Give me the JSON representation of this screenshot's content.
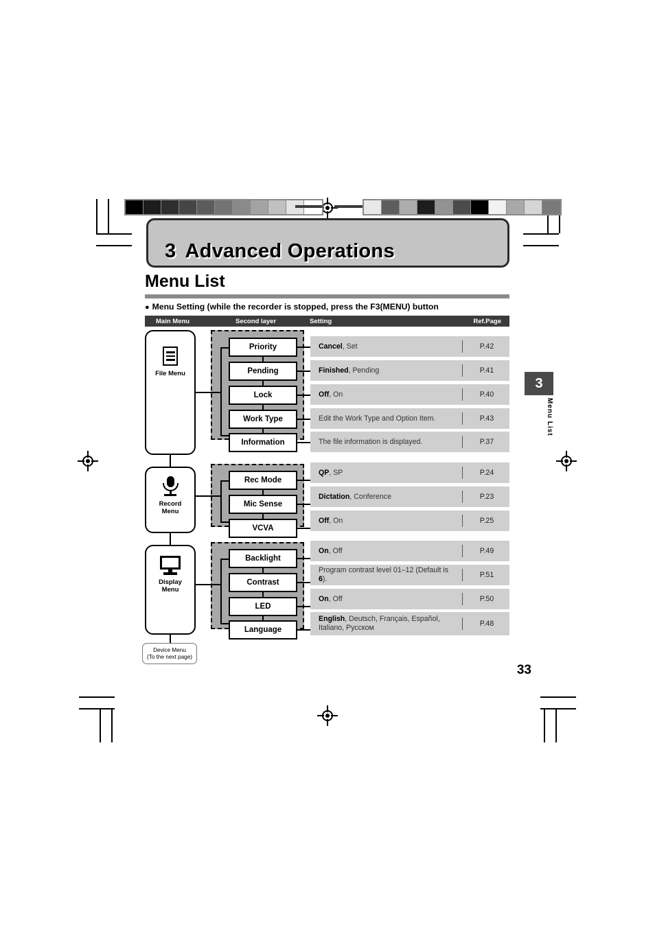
{
  "page": {
    "number": "33",
    "chapter_number": "3",
    "chapter_title": "Advanced Operations",
    "section_title": "Menu List",
    "bullet_text": "Menu Setting (while the recorder is stopped, press the F3(MENU) button",
    "bullet_marker": "●",
    "side_tab_number": "3",
    "side_tab_label": "Menu List"
  },
  "table": {
    "headers": {
      "main_menu": "Main Menu",
      "second_layer": "Second layer",
      "setting": "Setting",
      "ref_page": "Ref.Page"
    }
  },
  "groups": [
    {
      "main": {
        "label_line1": "File Menu",
        "label_line2": "",
        "icon": "file-icon"
      },
      "items": [
        {
          "name": "Priority",
          "setting_bold": "Cancel",
          "setting_rest": ", Set",
          "ref": "P.42"
        },
        {
          "name": "Pending",
          "setting_bold": "Finished",
          "setting_rest": ", Pending",
          "ref": "P.41"
        },
        {
          "name": "Lock",
          "setting_bold": "Off",
          "setting_rest": ", On",
          "ref": "P.40"
        },
        {
          "name": "Work Type",
          "setting_bold": "",
          "setting_rest": "Edit the Work Type and Option Item.",
          "ref": "P.43"
        },
        {
          "name": "Information",
          "setting_bold": "",
          "setting_rest": "The file information is displayed.",
          "ref": "P.37"
        }
      ]
    },
    {
      "main": {
        "label_line1": "Record",
        "label_line2": "Menu",
        "icon": "microphone-icon"
      },
      "items": [
        {
          "name": "Rec Mode",
          "setting_bold": "QP",
          "setting_rest": ", SP",
          "ref": "P.24"
        },
        {
          "name": "Mic Sense",
          "setting_bold": "Dictation",
          "setting_rest": ", Conference",
          "ref": "P.23"
        },
        {
          "name": "VCVA",
          "setting_bold": "Off",
          "setting_rest": ", On",
          "ref": "P.25"
        }
      ]
    },
    {
      "main": {
        "label_line1": "Display",
        "label_line2": "Menu",
        "icon": "display-icon"
      },
      "items": [
        {
          "name": "Backlight",
          "setting_bold": "On",
          "setting_rest": ", Off",
          "ref": "P.49"
        },
        {
          "name": "Contrast",
          "setting_bold": "",
          "setting_rest": "Program contrast level 01–12 (Default is ",
          "setting_bold2": "6",
          "setting_tail": ").",
          "ref": "P.51"
        },
        {
          "name": "LED",
          "setting_bold": "On",
          "setting_rest": ", Off",
          "ref": "P.50"
        },
        {
          "name": "Language",
          "setting_bold": "English",
          "setting_rest": ", Deutsch, Français, Español, Italiano, Русском",
          "ref": "P.48"
        }
      ]
    }
  ],
  "device_menu": {
    "line1": "Device Menu",
    "line2": "(To the next page)"
  },
  "colors": {
    "header_bar": "#3b3b3b",
    "row_bg": "#cfcfcf",
    "group_bg": "#a8a8a8",
    "banner_bg": "#c4c4c4",
    "rule": "#8b8b8b",
    "side_tab": "#4a4a4a"
  },
  "color_bar_left": [
    "#000000",
    "#1c1c1c",
    "#2e2e2e",
    "#454545",
    "#5c5c5c",
    "#737373",
    "#8a8a8a",
    "#a3a3a3",
    "#c0c0c0",
    "#e4e4e4",
    "#ffffff"
  ],
  "color_bar_right": [
    "#e8e8e8",
    "#5e5e5e",
    "#adadad",
    "#1d1d1d",
    "#939393",
    "#4b4b4b",
    "#000000",
    "#f2f2f2",
    "#a9a9a9",
    "#d5d5d5",
    "#7a7a7a"
  ]
}
